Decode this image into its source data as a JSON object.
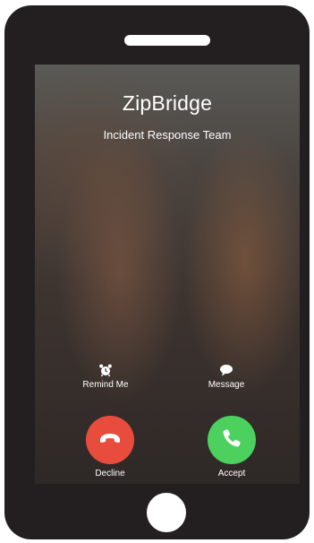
{
  "call": {
    "caller_name": "ZipBridge",
    "caller_subtitle": "Incident Response Team"
  },
  "actions": {
    "remind_label": "Remind Me",
    "remind_icon": "alarm-clock-icon",
    "message_label": "Message",
    "message_icon": "speech-bubble-icon"
  },
  "buttons": {
    "decline_label": "Decline",
    "decline_icon": "phone-hangup-icon",
    "decline_color": "#e74c3c",
    "accept_label": "Accept",
    "accept_icon": "phone-icon",
    "accept_color": "#4cd15f"
  },
  "device": {
    "body_color": "#231f20"
  }
}
